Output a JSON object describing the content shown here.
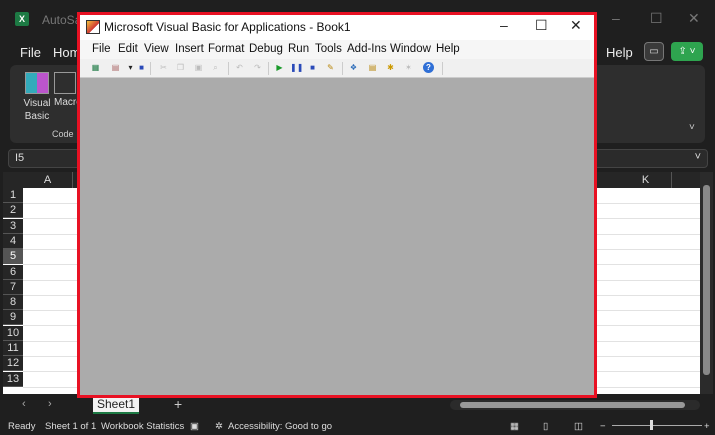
{
  "excel": {
    "autosave": "AutoSave",
    "menu": [
      "File",
      "Home",
      "Help"
    ],
    "ribbon": {
      "visual_basic": "Visual Basic",
      "macros": "Macros",
      "group": "Code"
    },
    "name_box": "I5",
    "columns": [
      "A",
      "K"
    ],
    "rows": [
      "1",
      "2",
      "3",
      "4",
      "5",
      "6",
      "7",
      "8",
      "9",
      "10",
      "11",
      "12",
      "13"
    ],
    "selected_row": "5",
    "sheet_tab": "Sheet1",
    "status": {
      "ready": "Ready",
      "sheet": "Sheet 1 of 1",
      "stats": "Workbook Statistics",
      "accessibility": "Accessibility: Good to go"
    },
    "accent": "#1d7a44"
  },
  "vba": {
    "title": "Microsoft Visual Basic for Applications - Book1",
    "menu": [
      "File",
      "Edit",
      "View",
      "Insert",
      "Format",
      "Debug",
      "Run",
      "Tools",
      "Add-Ins",
      "Window",
      "Help"
    ],
    "toolbar": [
      "view-excel-icon",
      "insert-userform-icon",
      "dropdown-icon",
      "save-icon",
      "cut-icon",
      "copy-icon",
      "paste-icon",
      "find-icon",
      "undo-icon",
      "redo-icon",
      "run-icon",
      "break-icon",
      "reset-icon",
      "design-mode-icon",
      "project-explorer-icon",
      "properties-icon",
      "object-browser-icon",
      "toolbox-icon",
      "help-icon"
    ],
    "border_color": "#e81123"
  }
}
